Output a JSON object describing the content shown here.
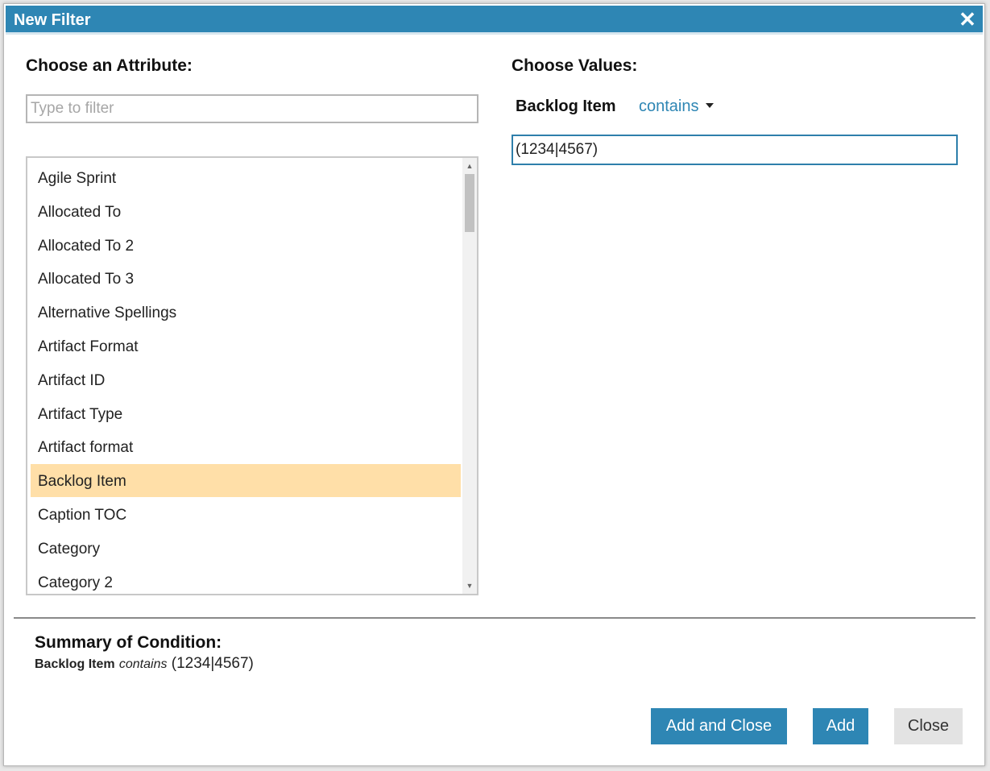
{
  "dialog": {
    "title": "New Filter",
    "close_glyph": "✕"
  },
  "attribute_panel": {
    "heading": "Choose an Attribute:",
    "filter_placeholder": "Type to filter",
    "items": [
      {
        "label": "Agile Sprint",
        "selected": false
      },
      {
        "label": "Allocated To",
        "selected": false
      },
      {
        "label": "Allocated To 2",
        "selected": false
      },
      {
        "label": "Allocated To 3",
        "selected": false
      },
      {
        "label": "Alternative Spellings",
        "selected": false
      },
      {
        "label": "Artifact Format",
        "selected": false
      },
      {
        "label": "Artifact ID",
        "selected": false
      },
      {
        "label": "Artifact Type",
        "selected": false
      },
      {
        "label": "Artifact format",
        "selected": false
      },
      {
        "label": "Backlog Item",
        "selected": true
      },
      {
        "label": "Caption TOC",
        "selected": false
      },
      {
        "label": "Category",
        "selected": false
      },
      {
        "label": "Category 2",
        "selected": false
      }
    ]
  },
  "values_panel": {
    "heading": "Choose Values:",
    "field_name": "Backlog Item",
    "operator": "contains",
    "value": "(1234|4567)"
  },
  "summary": {
    "heading": "Summary of Condition:",
    "field": "Backlog Item",
    "operator": "contains",
    "value": "(1234|4567)"
  },
  "buttons": {
    "add_and_close": "Add and Close",
    "add": "Add",
    "close": "Close"
  },
  "colors": {
    "accent": "#2e86b4",
    "selected_row": "#ffdfa8"
  },
  "icons": {
    "close": "close-icon",
    "dropdown": "caret-down-icon",
    "scroll_up": "scroll-up-icon",
    "scroll_down": "scroll-down-icon"
  }
}
